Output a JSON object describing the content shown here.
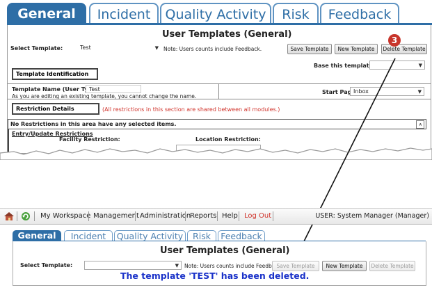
{
  "top": {
    "tabs": [
      {
        "label": "General",
        "active": true
      },
      {
        "label": "Incident",
        "active": false
      },
      {
        "label": "Quality Activity",
        "active": false
      },
      {
        "label": "Risk",
        "active": false
      },
      {
        "label": "Feedback",
        "active": false
      }
    ],
    "title": "User Templates (General)",
    "select_label": "Select Template:",
    "select_value": "Test",
    "note": "Note: Users counts include Feedback.",
    "buttons": {
      "save": "Save Template",
      "new": "New Template",
      "delete": "Delete Template"
    },
    "step_badge": "3",
    "base_label": "Base this template on:",
    "template_identification": "Template Identification",
    "template_name_label": "Template Name (User Type):",
    "template_name_value": "Test",
    "editing_note": "As you are editing an existing template, you cannot change the name.",
    "start_page_label": "Start Page:",
    "start_page_value": "Inbox",
    "restriction_details": "Restriction Details",
    "restriction_note": "(All restrictions in this section are shared between all modules.)",
    "no_restrictions": "No Restrictions in this area have any selected items.",
    "entry_update": "Entry/Update Restrictions",
    "facility_restriction": "Facility Restriction:",
    "location_restriction": "Location Restriction:",
    "collapse_icon": "«"
  },
  "nav": {
    "items": [
      "My Workspace",
      "Management",
      "Administration",
      "Reports",
      "Help",
      "Log Out"
    ],
    "user": "USER: System Manager (Manager)"
  },
  "bottom": {
    "tabs": [
      {
        "label": "General",
        "active": true
      },
      {
        "label": "Incident",
        "active": false
      },
      {
        "label": "Quality Activity",
        "active": false
      },
      {
        "label": "Risk",
        "active": false
      },
      {
        "label": "Feedback",
        "active": false
      }
    ],
    "title": "User Templates (General)",
    "select_label": "Select Template:",
    "select_value": "",
    "note": "Note: Users counts include Feedback.",
    "buttons": {
      "save": "Save Template",
      "new": "New Template",
      "delete": "Delete Template"
    },
    "message": "The template 'TEST' has been deleted."
  },
  "colors": {
    "tab_blue": "#2e6ea6",
    "badge_red": "#c8352b",
    "logout_red": "#d0332b",
    "message_blue": "#1a32c9"
  }
}
